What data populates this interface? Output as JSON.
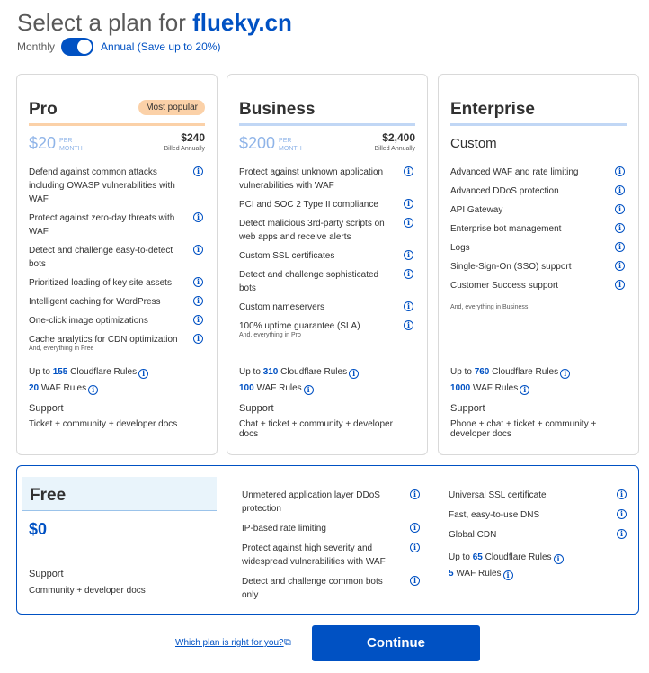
{
  "header": {
    "title_prefix": "Select a plan for ",
    "domain": "flueky.cn"
  },
  "billing": {
    "monthly_label": "Monthly",
    "annual_label": "Annual (Save up to 20%)",
    "annual_selected": true
  },
  "plans": {
    "pro": {
      "name": "Pro",
      "badge": "Most popular",
      "price": "$20",
      "per": "PER",
      "month": "MONTH",
      "billed_total": "$240",
      "billed_note": "Billed Annually",
      "features": [
        "Defend against common attacks including OWASP vulnerabilities with WAF",
        "Protect against zero-day threats with WAF",
        "Detect and challenge easy-to-detect bots",
        "Prioritized loading of key site assets",
        "Intelligent caching for WordPress",
        "One-click image optimizations",
        "Cache analytics for CDN optimization"
      ],
      "everything": "And, everything in Free",
      "rules_prefix": "Up to",
      "rules_count": "155",
      "rules_suffix": "Cloudflare Rules",
      "waf_count": "20",
      "waf_suffix": "WAF Rules",
      "support_label": "Support",
      "support_text": "Ticket + community + developer docs"
    },
    "business": {
      "name": "Business",
      "price": "$200",
      "per": "PER",
      "month": "MONTH",
      "billed_total": "$2,400",
      "billed_note": "Billed Annually",
      "features": [
        "Protect against unknown application vulnerabilities with WAF",
        "PCI and SOC 2 Type II compliance",
        "Detect malicious 3rd-party scripts on web apps and receive alerts",
        "Custom SSL certificates",
        "Detect and challenge sophisticated bots",
        "Custom nameservers",
        "100% uptime guarantee (SLA)"
      ],
      "everything": "And, everything in Pro",
      "rules_prefix": "Up to",
      "rules_count": "310",
      "rules_suffix": "Cloudflare Rules",
      "waf_count": "100",
      "waf_suffix": "WAF Rules",
      "support_label": "Support",
      "support_text": "Chat + ticket + community + developer docs"
    },
    "enterprise": {
      "name": "Enterprise",
      "price_text": "Custom",
      "features": [
        "Advanced WAF and rate limiting",
        "Advanced DDoS protection",
        "API Gateway",
        "Enterprise bot management",
        "Logs",
        "Single-Sign-On (SSO) support",
        "Customer Success support"
      ],
      "everything": "And, everything in Business",
      "rules_prefix": "Up to",
      "rules_count": "760",
      "rules_suffix": "Cloudflare Rules",
      "waf_count": "1000",
      "waf_suffix": "WAF Rules",
      "support_label": "Support",
      "support_text": "Phone + chat + ticket + community + developer docs"
    },
    "free": {
      "name": "Free",
      "price": "$0",
      "support_label": "Support",
      "support_text": "Community + developer docs",
      "features_col1": [
        "Unmetered application layer DDoS protection",
        "IP-based rate limiting",
        "Protect against high severity and widespread vulnerabilities with WAF",
        "Detect and challenge common bots only"
      ],
      "features_col2": [
        "Universal SSL certificate",
        "Fast, easy-to-use DNS",
        "Global CDN"
      ],
      "rules_prefix": "Up to",
      "rules_count": "65",
      "rules_suffix": "Cloudflare Rules",
      "waf_count": "5",
      "waf_suffix": "WAF Rules"
    }
  },
  "footer": {
    "help_link": "Which plan is right for you?",
    "continue_label": "Continue"
  },
  "icons": {
    "info": "info-circle-icon",
    "external": "external-link-icon"
  },
  "colors": {
    "accent": "#0051c3",
    "pro_accent": "#fbd1a8",
    "plan_bar": "#c1d7f5",
    "free_head_bg": "#e9f4fb",
    "price_muted": "#8fb4e8"
  }
}
